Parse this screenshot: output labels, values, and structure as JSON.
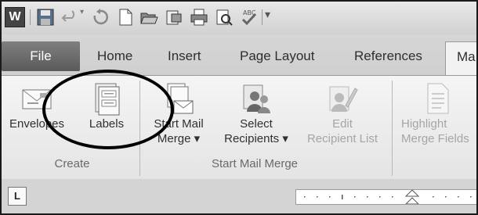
{
  "window": {
    "app_logo": "W"
  },
  "quick_access": {
    "icons": [
      "save-icon",
      "undo-icon",
      "redo-icon",
      "new-icon",
      "open-icon",
      "print-preview-icon",
      "print-icon",
      "zoom-icon",
      "spelling-icon",
      "customize-icon"
    ],
    "spelling_badge": "ABC"
  },
  "tabs": {
    "file": "File",
    "items": [
      "Home",
      "Insert",
      "Page Layout",
      "References",
      "Ma"
    ]
  },
  "ribbon": {
    "groups": [
      {
        "label": "Create",
        "commands": [
          {
            "label": "Envelopes",
            "icon": "envelope-icon",
            "enabled": true
          },
          {
            "label": "Labels",
            "icon": "labels-icon",
            "enabled": true
          }
        ]
      },
      {
        "label": "Start Mail Merge",
        "commands": [
          {
            "line1": "Start Mail",
            "line2": "Merge ▾",
            "icon": "start-mail-merge-icon",
            "enabled": true
          },
          {
            "line1": "Select",
            "line2": "Recipients ▾",
            "icon": "select-recipients-icon",
            "enabled": true
          },
          {
            "line1": "Edit",
            "line2": "Recipient List",
            "icon": "edit-recipient-list-icon",
            "enabled": false
          }
        ]
      },
      {
        "label": "",
        "commands": [
          {
            "line1": "Highlight",
            "line2": "Merge Fields",
            "icon": "highlight-merge-fields-icon",
            "enabled": false
          }
        ]
      }
    ]
  },
  "bottom": {
    "ruler_toggle": "L"
  },
  "annotation": {
    "type": "hand-drawn circle around Labels",
    "color": "#000000"
  }
}
